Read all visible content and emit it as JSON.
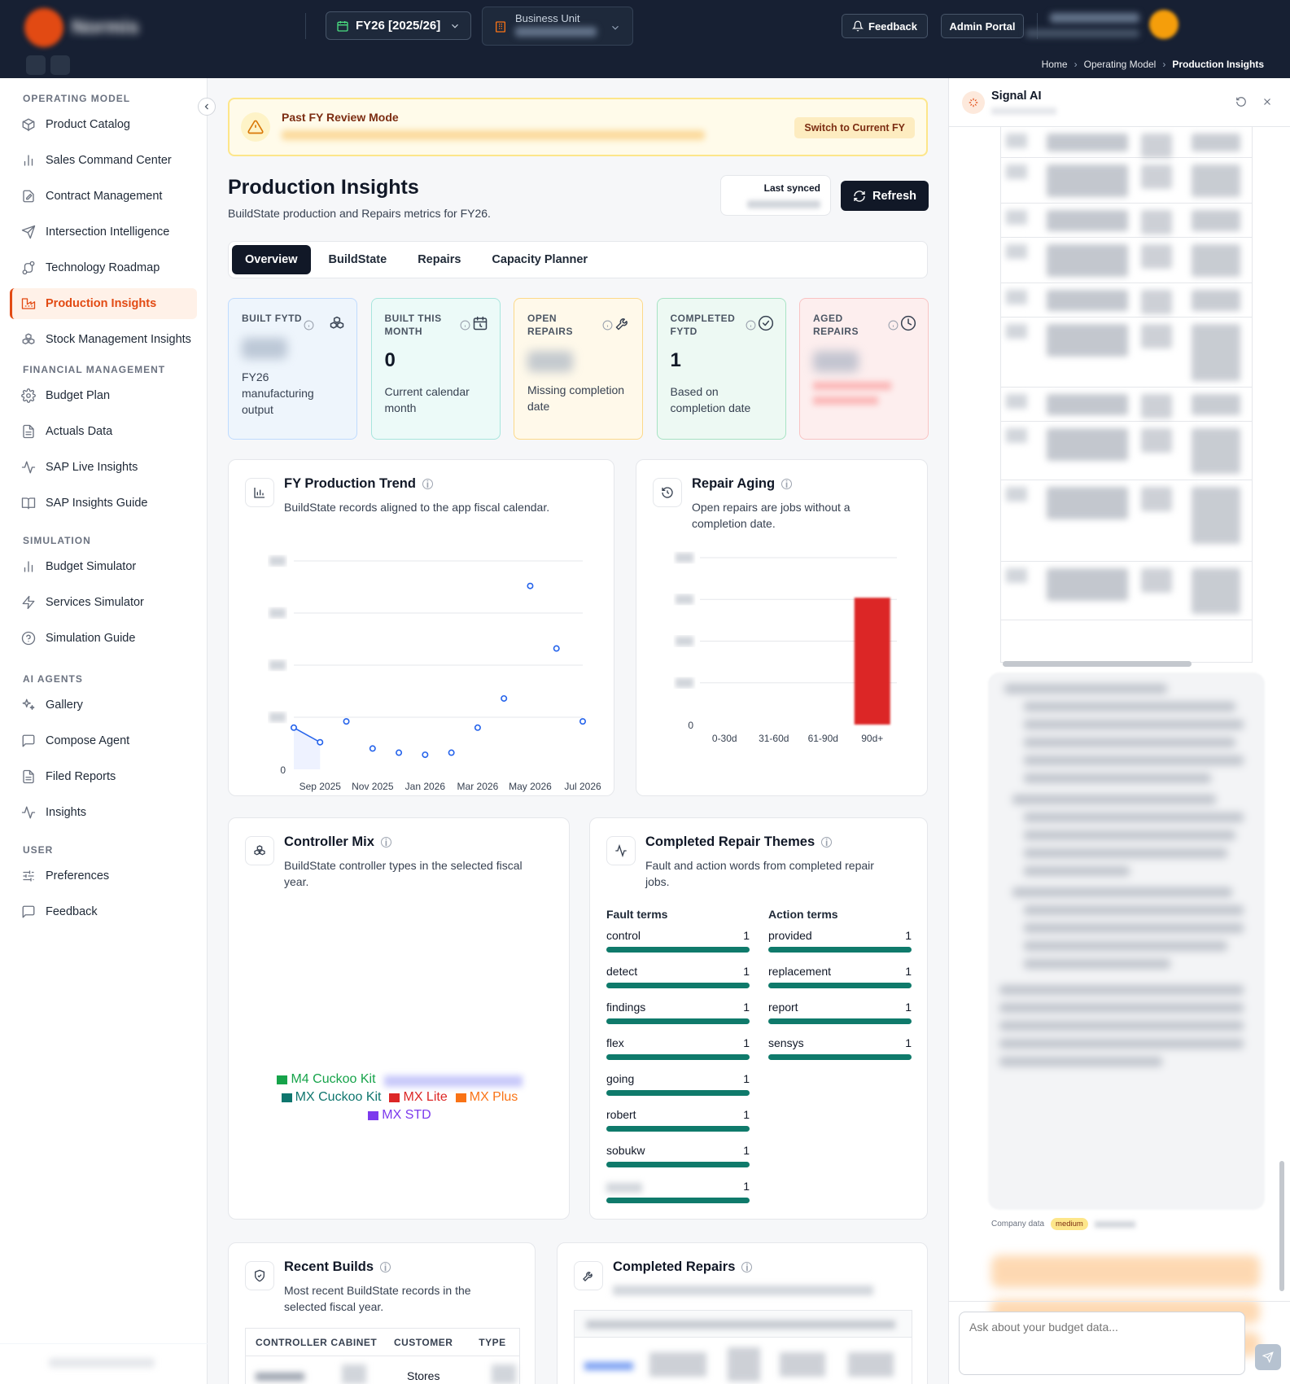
{
  "topbar": {
    "app_name": "Normis",
    "app_tagline": "",
    "fiscal_year": "FY26 [2025/26]",
    "business_unit_label": "Business Unit",
    "business_unit_value": "",
    "feedback_label": "Feedback",
    "admin_label": "Admin Portal",
    "brand_color": "#e24a13",
    "icons": [
      "calendar-icon",
      "building-icon",
      "bell-icon"
    ]
  },
  "breadcrumb": [
    "Home",
    "Operating Model",
    "Production Insights"
  ],
  "sidebar": {
    "sections": [
      {
        "title": "OPERATING MODEL",
        "items": [
          {
            "label": "Product Catalog",
            "icon": "box-icon"
          },
          {
            "label": "Sales Command Center",
            "icon": "bar-chart-icon"
          },
          {
            "label": "Contract Management",
            "icon": "document-edit-icon"
          },
          {
            "label": "Intersection Intelligence",
            "icon": "send-icon"
          },
          {
            "label": "Technology Roadmap",
            "icon": "route-icon"
          },
          {
            "label": "Production Insights",
            "icon": "factory-icon",
            "active": true
          },
          {
            "label": "Stock Management Insights",
            "icon": "boxes-icon"
          }
        ]
      },
      {
        "title": "FINANCIAL MANAGEMENT",
        "items": [
          {
            "label": "Budget Plan",
            "icon": "gear-icon"
          },
          {
            "label": "Actuals Data",
            "icon": "file-icon"
          },
          {
            "label": "SAP Live Insights",
            "icon": "activity-icon"
          },
          {
            "label": "SAP Insights Guide",
            "icon": "book-icon"
          }
        ]
      },
      {
        "title": "SIMULATION",
        "items": [
          {
            "label": "Budget Simulator",
            "icon": "bar-chart-icon"
          },
          {
            "label": "Services Simulator",
            "icon": "zap-icon"
          },
          {
            "label": "Simulation Guide",
            "icon": "help-circle-icon"
          }
        ]
      },
      {
        "title": "AI AGENTS",
        "items": [
          {
            "label": "Gallery",
            "icon": "sparkles-icon"
          },
          {
            "label": "Compose Agent",
            "icon": "message-icon"
          },
          {
            "label": "Filed Reports",
            "icon": "file-icon"
          },
          {
            "label": "Insights",
            "icon": "activity-icon"
          }
        ]
      },
      {
        "title": "USER",
        "items": [
          {
            "label": "Preferences",
            "icon": "sliders-icon"
          },
          {
            "label": "Feedback",
            "icon": "message-icon"
          }
        ]
      }
    ]
  },
  "banner": {
    "title": "Past FY Review Mode",
    "button": "Switch to Current FY"
  },
  "page": {
    "title": "Production Insights",
    "subtitle": "BuildState production and Repairs metrics for FY26.",
    "last_synced_label": "Last synced",
    "refresh_label": "Refresh"
  },
  "tabs": [
    "Overview",
    "BuildState",
    "Repairs",
    "Capacity Planner"
  ],
  "kpis": [
    {
      "label": "BUILT FYTD",
      "value": "",
      "desc": "FY26 manufacturing output",
      "bg": "#eef5fc",
      "border": "#bfdbfe",
      "icon": "boxes-icon"
    },
    {
      "label": "BUILT THIS MONTH",
      "value": "0",
      "desc": "Current calendar month",
      "bg": "#ecfaf8",
      "border": "#a7e6dd",
      "icon": "calendar-clock-icon"
    },
    {
      "label": "OPEN REPAIRS",
      "value": "",
      "desc": "Missing completion date",
      "bg": "#fff9ea",
      "border": "#fcd98a",
      "icon": "wrench-icon"
    },
    {
      "label": "COMPLETED FYTD",
      "value": "1",
      "desc": "Based on completion date",
      "bg": "#edf9f3",
      "border": "#a7e3c4",
      "icon": "check-circle-icon"
    },
    {
      "label": "AGED REPAIRS",
      "value": "",
      "desc": "",
      "bg": "#fdeeee",
      "border": "#f9c3c3",
      "icon": "clock-icon"
    }
  ],
  "trend_card": {
    "title": "FY Production Trend",
    "subtitle": "BuildState records aligned to the app fiscal calendar."
  },
  "aging_card": {
    "title": "Repair Aging",
    "subtitle": "Open repairs are jobs without a completion date."
  },
  "controller_card": {
    "title": "Controller Mix",
    "subtitle": "BuildState controller types in the selected fiscal year.",
    "legend": [
      {
        "name": "M4 Cuckoo Kit",
        "color": "#16a34a"
      },
      {
        "name": "MX Cuckoo Kit",
        "color": "#0f766e"
      },
      {
        "name": "MX Lite",
        "color": "#dc2626"
      },
      {
        "name": "MX Plus",
        "color": "#f97316"
      },
      {
        "name": "MX STD",
        "color": "#7c3aed"
      }
    ]
  },
  "themes_card": {
    "title": "Completed Repair Themes",
    "subtitle": "Fault and action words from completed repair jobs.",
    "fault_header": "Fault terms",
    "action_header": "Action terms",
    "fault_terms": [
      {
        "term": "control",
        "count": "1"
      },
      {
        "term": "detect",
        "count": "1"
      },
      {
        "term": "findings",
        "count": "1"
      },
      {
        "term": "flex",
        "count": "1"
      },
      {
        "term": "going",
        "count": "1"
      },
      {
        "term": "robert",
        "count": "1"
      },
      {
        "term": "sobukw",
        "count": "1"
      },
      {
        "term": "",
        "count": "1"
      }
    ],
    "action_terms": [
      {
        "term": "provided",
        "count": "1"
      },
      {
        "term": "replacement",
        "count": "1"
      },
      {
        "term": "report",
        "count": "1"
      },
      {
        "term": "sensys",
        "count": "1"
      }
    ]
  },
  "recent_builds": {
    "title": "Recent Builds",
    "subtitle": "Most recent BuildState records in the selected fiscal year.",
    "columns": [
      "CONTROLLER",
      "CABINET",
      "CUSTOMER",
      "TYPE"
    ],
    "first_row_customer": "Stores"
  },
  "completed_repairs": {
    "title": "Completed Repairs"
  },
  "ai_panel": {
    "title": "Signal AI",
    "meta_source": "Company data",
    "meta_confidence": "medium",
    "input_placeholder": "Ask about your budget data..."
  },
  "chart_data": [
    {
      "type": "line",
      "title": "FY Production Trend",
      "x": [
        "Aug 2025",
        "Sep 2025",
        "Oct 2025",
        "Nov 2025",
        "Dec 2025",
        "Jan 2026",
        "Feb 2026",
        "Mar 2026",
        "Apr 2026",
        "May 2026",
        "Jun 2026",
        "Jul 2026"
      ],
      "x_tick_labels": [
        "Sep 2025",
        "Nov 2025",
        "Jan 2026",
        "Mar 2026",
        "May 2026",
        "Jul 2026"
      ],
      "y_tick_labels": [
        "0"
      ],
      "values": [
        20,
        13,
        23,
        10,
        8,
        7,
        8,
        20,
        34,
        88,
        58,
        23
      ],
      "ylim": [
        0,
        100
      ],
      "grid": true
    },
    {
      "type": "bar",
      "title": "Repair Aging",
      "categories": [
        "0-30d",
        "31-60d",
        "61-90d",
        "90d+"
      ],
      "values": [
        0,
        0,
        0,
        38
      ],
      "y_tick_labels": [
        "0"
      ],
      "ylim": [
        0,
        50
      ],
      "colors": [
        "#dc2626",
        "#dc2626",
        "#dc2626",
        "#dc2626"
      ],
      "grid": true
    }
  ]
}
